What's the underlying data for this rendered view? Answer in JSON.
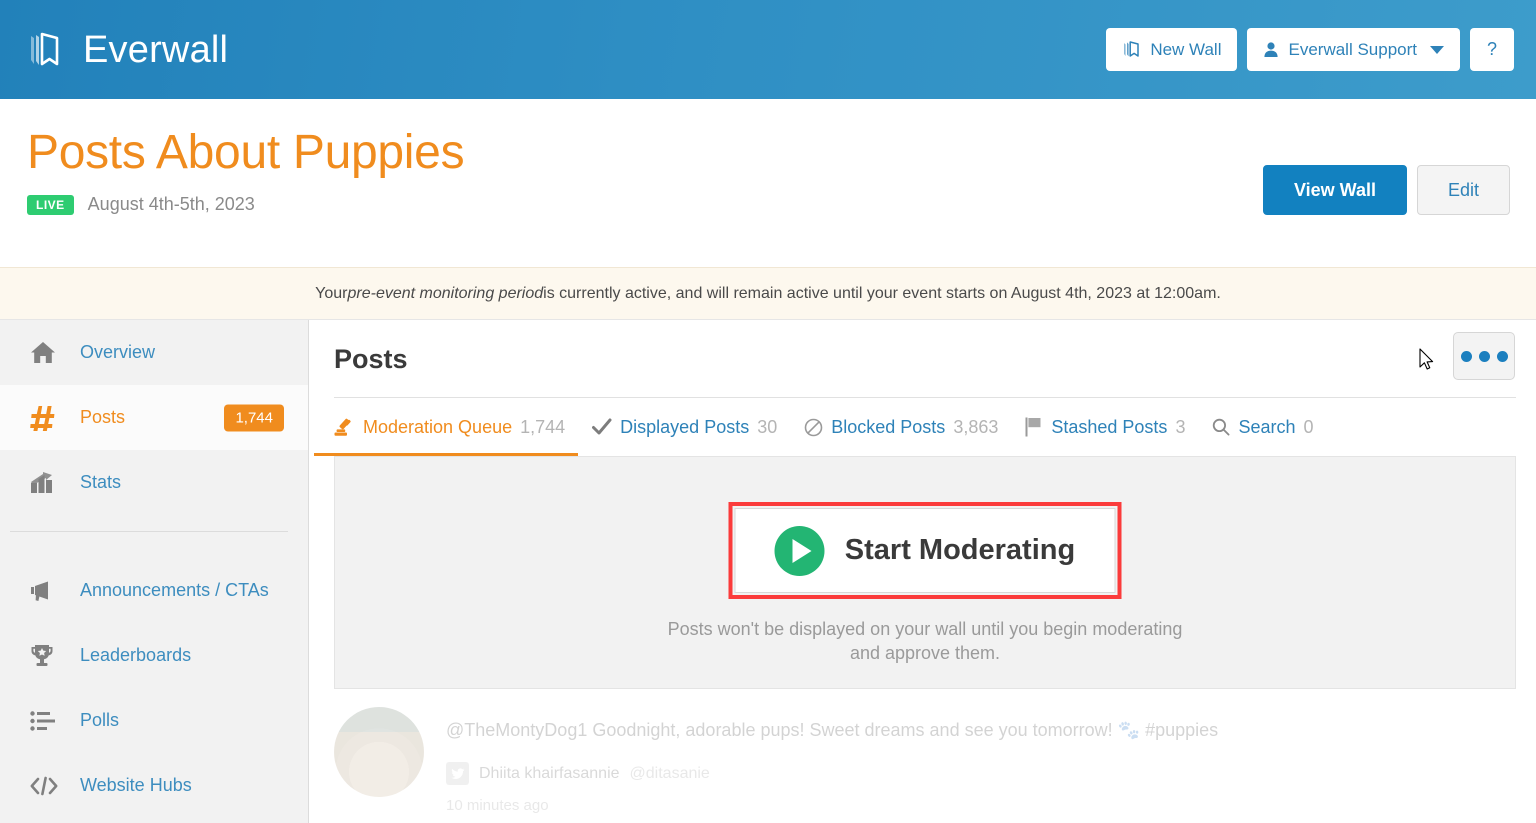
{
  "topbar": {
    "brand_name": "Everwall",
    "brand_icon": "everwall-book-logo",
    "buttons": [
      {
        "label": "New Wall",
        "icon": "book-icon"
      },
      {
        "label": "Everwall Support",
        "icon": "user-icon",
        "caret": "chevron-down-icon"
      },
      {
        "label": "?",
        "icon": "help-icon"
      }
    ],
    "accent_bg": "#2f8fc4",
    "link_color": "#2e82b8"
  },
  "titlebar": {
    "page_title": "Posts About Puppies",
    "title_color": "#f08c1e",
    "status_badge": "LIVE",
    "status_color": "#2ecc71",
    "event_dates": "August 4th-5th, 2023",
    "view_wall_label": "View Wall",
    "edit_label": "Edit"
  },
  "notice": {
    "prefix": "Your ",
    "emphasis": "pre-event monitoring period",
    "suffix": " is currently active, and will remain active until your event starts on August 4th, 2023 at 12:00am.",
    "bg": "#fdf8ee"
  },
  "sidebar": {
    "items": [
      {
        "label": "Overview",
        "icon": "home-icon",
        "badge": "",
        "active": false
      },
      {
        "label": "Posts",
        "icon": "hashtag-icon",
        "badge": "1,744",
        "active": true
      },
      {
        "label": "Stats",
        "icon": "bar-chart-icon",
        "badge": "",
        "active": false
      },
      {
        "label": "Announcements / CTAs",
        "icon": "megaphone-icon",
        "badge": "",
        "active": false
      },
      {
        "label": "Leaderboards",
        "icon": "trophy-icon",
        "badge": "",
        "active": false
      },
      {
        "label": "Polls",
        "icon": "list-icon",
        "badge": "",
        "active": false
      },
      {
        "label": "Website Hubs",
        "icon": "code-icon",
        "badge": "",
        "active": false
      }
    ],
    "badge_color": "#f08c1e"
  },
  "main": {
    "title": "Posts",
    "overflow_menu": "ellipsis-icon",
    "tabs": [
      {
        "label": "Moderation Queue",
        "count": "1,744",
        "icon": "gavel-icon",
        "active": true
      },
      {
        "label": "Displayed Posts",
        "count": "30",
        "icon": "check-icon",
        "active": false
      },
      {
        "label": "Blocked Posts",
        "count": "3,863",
        "icon": "blocked-icon",
        "active": false
      },
      {
        "label": "Stashed Posts",
        "count": "3",
        "icon": "flag-icon",
        "active": false
      },
      {
        "label": "Search",
        "count": "0",
        "icon": "search-icon",
        "active": false
      }
    ],
    "panel": {
      "moderate_button_label": "Start Moderating",
      "moderate_icon": "play-icon",
      "highlight_color": "#fb3b3b",
      "note_line1": "Posts won't be displayed on your wall until you begin moderating",
      "note_line2": "and approve them."
    },
    "posts": [
      {
        "text": "@TheMontyDog1 Goodnight, adorable pups! Sweet dreams and see you tomorrow! 🐾 ",
        "hashtag": "#puppies",
        "author": "Dhiita khairfasannie",
        "handle": "@ditasanie",
        "time": "10 minutes ago",
        "network_icon": "twitter-icon",
        "avatar": "user-avatar"
      }
    ]
  }
}
